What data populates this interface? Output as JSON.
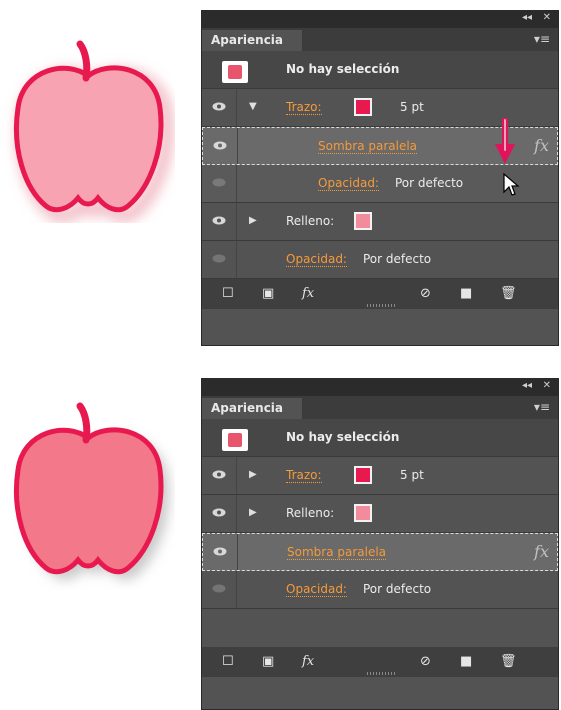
{
  "panel_top": {
    "tab_label": "Apariencia",
    "header_label": "No hay selección",
    "rows": {
      "trazo": {
        "label": "Trazo:",
        "value": "5 pt"
      },
      "sombra": {
        "label": "Sombra paralela"
      },
      "opacidad_inner": {
        "label": "Opacidad:",
        "value": "Por defecto"
      },
      "relleno": {
        "label": "Relleno:"
      },
      "opacidad": {
        "label": "Opacidad:",
        "value": "Por defecto"
      }
    }
  },
  "panel_bottom": {
    "tab_label": "Apariencia",
    "header_label": "No hay selección",
    "rows": {
      "trazo": {
        "label": "Trazo:",
        "value": "5 pt"
      },
      "relleno": {
        "label": "Relleno:"
      },
      "sombra": {
        "label": "Sombra paralela"
      },
      "opacidad": {
        "label": "Opacidad:",
        "value": "Por defecto"
      }
    }
  },
  "common": {
    "collapse_glyph": "◂◂",
    "close_glyph": "✕",
    "fx_glyph": "fx",
    "menu_glyph": "▾≡"
  },
  "colors": {
    "stroke_swatch": "#e8194f",
    "fill_swatch": "#f28b9c",
    "label_orange": "#f59a3b",
    "arrow_pink": "#e0145a"
  }
}
